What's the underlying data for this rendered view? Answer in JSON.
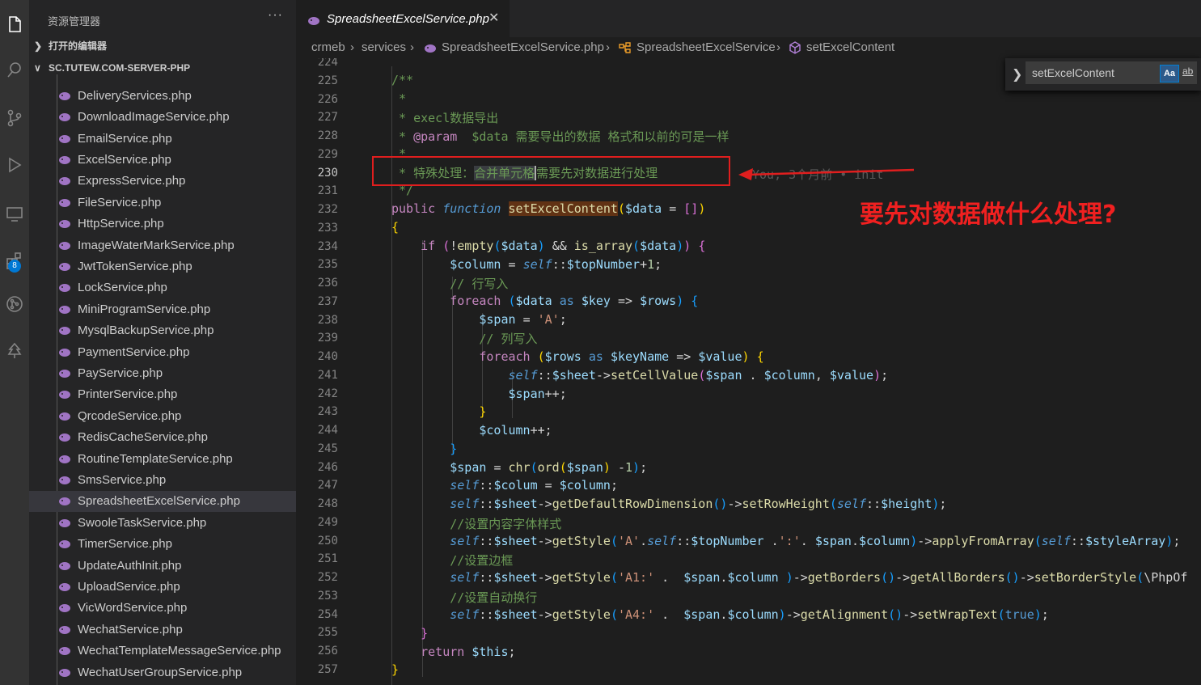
{
  "sidebar": {
    "title": "资源管理器",
    "more": "···",
    "sections": {
      "open_editors": "打开的编辑器",
      "project": "SC.TUTEW.COM-SERVER-PHP"
    },
    "files": [
      "DeliveryServices.php",
      "DownloadImageService.php",
      "EmailService.php",
      "ExcelService.php",
      "ExpressService.php",
      "FileService.php",
      "HttpService.php",
      "ImageWaterMarkService.php",
      "JwtTokenService.php",
      "LockService.php",
      "MiniProgramService.php",
      "MysqlBackupService.php",
      "PaymentService.php",
      "PayService.php",
      "PrinterService.php",
      "QrcodeService.php",
      "RedisCacheService.php",
      "RoutineTemplateService.php",
      "SmsService.php",
      "SpreadsheetExcelService.php",
      "SwooleTaskService.php",
      "TimerService.php",
      "UpdateAuthInit.php",
      "UploadService.php",
      "VicWordService.php",
      "WechatService.php",
      "WechatTemplateMessageService.php",
      "WechatUserGroupService.php"
    ],
    "selected_file": "SpreadsheetExcelService.php"
  },
  "activity": {
    "extensions_badge": "8",
    "icons": [
      "explorer-icon",
      "search-icon",
      "source-control-icon",
      "run-debug-icon",
      "remote-explorer-icon",
      "extensions-icon",
      "git-graph-icon",
      "tree-icon"
    ]
  },
  "tab": {
    "label": "SpreadsheetExcelService.php",
    "close": "✕"
  },
  "breadcrumb": {
    "items": [
      "crmeb",
      "services",
      "SpreadsheetExcelService.php",
      "SpreadsheetExcelService",
      "setExcelContent"
    ],
    "separator": "›"
  },
  "find": {
    "value": "setExcelContent",
    "case_label": "Aa",
    "word_label": "ab"
  },
  "editor": {
    "line_numbers": [
      "224",
      "225",
      "226",
      "227",
      "228",
      "229",
      "230",
      "231",
      "232",
      "233",
      "234",
      "235",
      "236",
      "237",
      "238",
      "239",
      "240",
      "241",
      "242",
      "243",
      "244",
      "245",
      "246",
      "247",
      "248",
      "249",
      "250",
      "251",
      "252",
      "253",
      "254",
      "255",
      "256",
      "257"
    ],
    "current_line": "230",
    "blame": "You, 3个月前 • init"
  },
  "annotation": "要先对数据做什么处理?",
  "colors": {
    "accent": "#0078d4",
    "annotation": "#f02020",
    "keyword": "#569cd6",
    "function": "#dcdcaa",
    "variable": "#9cdcfe",
    "comment": "#6a9955"
  }
}
